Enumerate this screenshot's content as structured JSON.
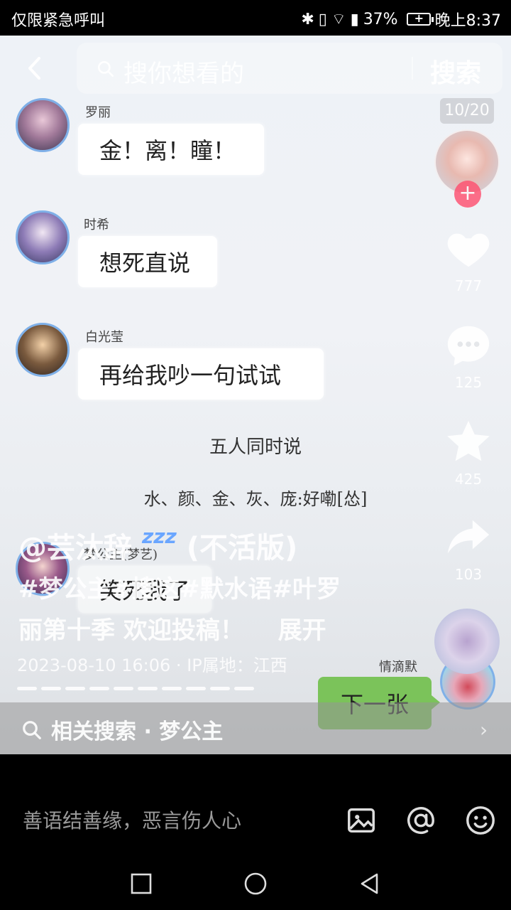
{
  "status_bar": {
    "left_text": "仅限紧急呼叫",
    "battery": "37%",
    "time": "晚上8:37"
  },
  "top_bar": {
    "search_placeholder": "搜你想看的",
    "search_button": "搜索",
    "counter": "10/20"
  },
  "chat": [
    {
      "name": "罗丽",
      "text": "金！离！瞳！"
    },
    {
      "name": "时希",
      "text": "想死直说"
    },
    {
      "name": "白光莹",
      "text": "再给我吵一句试试"
    },
    {
      "name": "梦公主(梦艺)",
      "text": "笑死我了"
    }
  ],
  "center_lines": {
    "line1": "五人同时说",
    "line2": "水、颜、金、灰、庞:好嘞[怂]"
  },
  "rail": {
    "like_count": "777",
    "comment_count": "125",
    "fav_count": "425",
    "share_count": "103"
  },
  "overlay": {
    "author": "@芸汰辞",
    "author_suffix": "(不活版)",
    "sleep_mark": "zzz",
    "desc_line1": "#梦公主#搜这#默水语#叶罗",
    "desc_line2": "丽第十季  欢迎投稿！",
    "expand": "展开",
    "date": "2023-08-10 16:06 · IP属地：江西"
  },
  "reply": {
    "name": "情滴默",
    "text": "下一张"
  },
  "related_search": {
    "label": "相关搜索 · 梦公主",
    "chevron": "›"
  },
  "comment_bar": {
    "placeholder": "善语结善缘，恶言伤人心"
  },
  "icons": {
    "back": "back-arrow-icon",
    "search": "search-icon",
    "image": "image-icon",
    "mention": "at-icon",
    "emoji": "emoji-icon"
  }
}
